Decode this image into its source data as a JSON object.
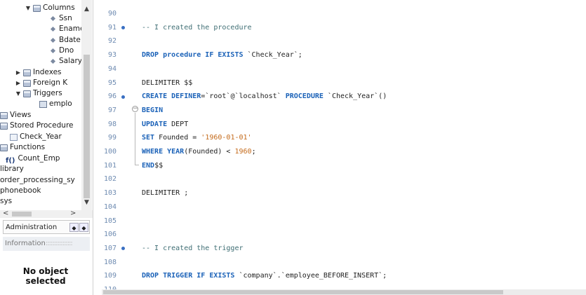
{
  "navigator": {
    "tree": [
      {
        "label": "Columns",
        "toggle": "▼",
        "icon": "folder"
      },
      {
        "label": "Ssn",
        "toggle": "",
        "icon": "column"
      },
      {
        "label": "Ename",
        "toggle": "",
        "icon": "column"
      },
      {
        "label": "Bdate",
        "toggle": "",
        "icon": "column"
      },
      {
        "label": "Dno",
        "toggle": "",
        "icon": "column"
      },
      {
        "label": "Salary",
        "toggle": "",
        "icon": "column"
      },
      {
        "label": "Indexes",
        "toggle": "▶",
        "icon": "folder"
      },
      {
        "label": "Foreign K",
        "toggle": "▶",
        "icon": "folder"
      },
      {
        "label": "Triggers",
        "toggle": "▼",
        "icon": "folder"
      },
      {
        "label": "emplo",
        "toggle": "",
        "icon": "trigger"
      },
      {
        "label": "Views",
        "toggle": "",
        "icon": "folder"
      },
      {
        "label": "Stored Procedure",
        "toggle": "",
        "icon": "folder"
      },
      {
        "label": "Check_Year",
        "toggle": "",
        "icon": "procedure"
      },
      {
        "label": "Functions",
        "toggle": "",
        "icon": "folder"
      },
      {
        "label": "Count_Emp",
        "toggle": "",
        "icon": "function"
      },
      {
        "label": "library",
        "toggle": "",
        "icon": "none"
      },
      {
        "label": "order_processing_sy",
        "toggle": "",
        "icon": "none"
      },
      {
        "label": "phonebook",
        "toggle": "",
        "icon": "none"
      },
      {
        "label": "sys",
        "toggle": "",
        "icon": "none"
      }
    ],
    "function_icon_text": "f()",
    "scroll_left": "<",
    "scroll_right": ">",
    "scroll_up": "▲",
    "scroll_down": "▼",
    "admin_tab": "Administration",
    "info_tab": "Information",
    "info_dots": "::::::::::::::::",
    "no_object": [
      "No object",
      "selected"
    ]
  },
  "editor": {
    "lines": [
      {
        "n": "90",
        "dot": false,
        "parts": []
      },
      {
        "n": "91",
        "dot": true,
        "parts": [
          {
            "t": "-- I created the procedure",
            "c": "cm"
          }
        ]
      },
      {
        "n": "92",
        "dot": false,
        "parts": []
      },
      {
        "n": "93",
        "dot": false,
        "parts": [
          {
            "t": "DROP procedure IF EXISTS",
            "c": "kw"
          },
          {
            "t": " `Check_Year`;",
            "c": "bq"
          }
        ]
      },
      {
        "n": "94",
        "dot": false,
        "parts": []
      },
      {
        "n": "95",
        "dot": false,
        "parts": [
          {
            "t": "DELIMITER $$",
            "c": "bq"
          }
        ]
      },
      {
        "n": "96",
        "dot": true,
        "parts": [
          {
            "t": "CREATE DEFINER",
            "c": "kw"
          },
          {
            "t": "=`root`@`localhost` ",
            "c": "bq"
          },
          {
            "t": "PROCEDURE",
            "c": "kw"
          },
          {
            "t": " `Check_Year`()",
            "c": "bq"
          }
        ]
      },
      {
        "n": "97",
        "dot": false,
        "parts": [
          {
            "t": "BEGIN",
            "c": "kw"
          }
        ]
      },
      {
        "n": "98",
        "dot": false,
        "parts": [
          {
            "t": "UPDATE",
            "c": "kw"
          },
          {
            "t": " DEPT",
            "c": "bq"
          }
        ]
      },
      {
        "n": "99",
        "dot": false,
        "parts": [
          {
            "t": "SET",
            "c": "kw"
          },
          {
            "t": " Founded = ",
            "c": "bq"
          },
          {
            "t": "'1960-01-01'",
            "c": "str"
          }
        ]
      },
      {
        "n": "100",
        "dot": false,
        "parts": [
          {
            "t": "WHERE YEAR",
            "c": "kw"
          },
          {
            "t": "(Founded) < ",
            "c": "bq"
          },
          {
            "t": "1960",
            "c": "num"
          },
          {
            "t": ";",
            "c": "bq"
          }
        ]
      },
      {
        "n": "101",
        "dot": false,
        "parts": [
          {
            "t": "END",
            "c": "kw"
          },
          {
            "t": "$$",
            "c": "bq"
          }
        ]
      },
      {
        "n": "102",
        "dot": false,
        "parts": []
      },
      {
        "n": "103",
        "dot": false,
        "parts": [
          {
            "t": "DELIMITER ;",
            "c": "bq"
          }
        ]
      },
      {
        "n": "104",
        "dot": false,
        "parts": []
      },
      {
        "n": "105",
        "dot": false,
        "parts": []
      },
      {
        "n": "106",
        "dot": false,
        "parts": []
      },
      {
        "n": "107",
        "dot": true,
        "parts": [
          {
            "t": "-- I created the trigger",
            "c": "cm"
          }
        ]
      },
      {
        "n": "108",
        "dot": false,
        "parts": []
      },
      {
        "n": "109",
        "dot": false,
        "parts": [
          {
            "t": "DROP TRIGGER IF EXISTS",
            "c": "kw"
          },
          {
            "t": " `company`.`employee_BEFORE_INSERT`;",
            "c": "bq"
          }
        ]
      },
      {
        "n": "110",
        "dot": false,
        "parts": []
      }
    ],
    "fold_symbol": "−"
  },
  "colors": {
    "keyword": "#1b62b8",
    "comment": "#3f6e74",
    "string": "#c46a1a",
    "line_number": "#6e8bb1",
    "marker_dot": "#3a6fc2"
  }
}
